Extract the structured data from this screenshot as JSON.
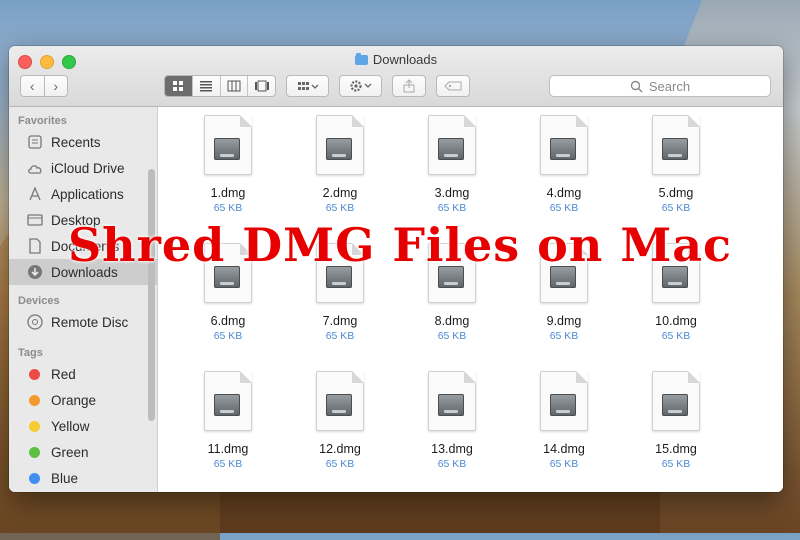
{
  "window": {
    "title": "Downloads"
  },
  "toolbar": {
    "back_icon": "‹",
    "forward_icon": "›",
    "search_placeholder": "Search"
  },
  "sidebar": {
    "favorites_heading": "Favorites",
    "favorites": [
      {
        "label": "Recents",
        "icon": "recents-icon"
      },
      {
        "label": "iCloud Drive",
        "icon": "cloud-icon"
      },
      {
        "label": "Applications",
        "icon": "applications-icon"
      },
      {
        "label": "Desktop",
        "icon": "desktop-icon"
      },
      {
        "label": "Documents",
        "icon": "documents-icon"
      },
      {
        "label": "Downloads",
        "icon": "downloads-icon",
        "selected": true
      }
    ],
    "devices_heading": "Devices",
    "devices": [
      {
        "label": "Remote Disc",
        "icon": "disc-icon"
      }
    ],
    "tags_heading": "Tags",
    "tags": [
      {
        "label": "Red",
        "color": "#ec4b45"
      },
      {
        "label": "Orange",
        "color": "#f29a2e"
      },
      {
        "label": "Yellow",
        "color": "#f5cc34"
      },
      {
        "label": "Green",
        "color": "#5cc143"
      },
      {
        "label": "Blue",
        "color": "#3f8ef0"
      }
    ]
  },
  "files": [
    {
      "name": "1.dmg",
      "size": "65 KB"
    },
    {
      "name": "2.dmg",
      "size": "65 KB"
    },
    {
      "name": "3.dmg",
      "size": "65 KB"
    },
    {
      "name": "4.dmg",
      "size": "65 KB"
    },
    {
      "name": "5.dmg",
      "size": "65 KB"
    },
    {
      "name": "6.dmg",
      "size": "65 KB"
    },
    {
      "name": "7.dmg",
      "size": "65 KB"
    },
    {
      "name": "8.dmg",
      "size": "65 KB"
    },
    {
      "name": "9.dmg",
      "size": "65 KB"
    },
    {
      "name": "10.dmg",
      "size": "65 KB"
    },
    {
      "name": "11.dmg",
      "size": "65 KB"
    },
    {
      "name": "12.dmg",
      "size": "65 KB"
    },
    {
      "name": "13.dmg",
      "size": "65 KB"
    },
    {
      "name": "14.dmg",
      "size": "65 KB"
    },
    {
      "name": "15.dmg",
      "size": "65 KB"
    }
  ],
  "overlay": {
    "text": "Shred DMG Files on Mac",
    "color": "#e60000"
  }
}
